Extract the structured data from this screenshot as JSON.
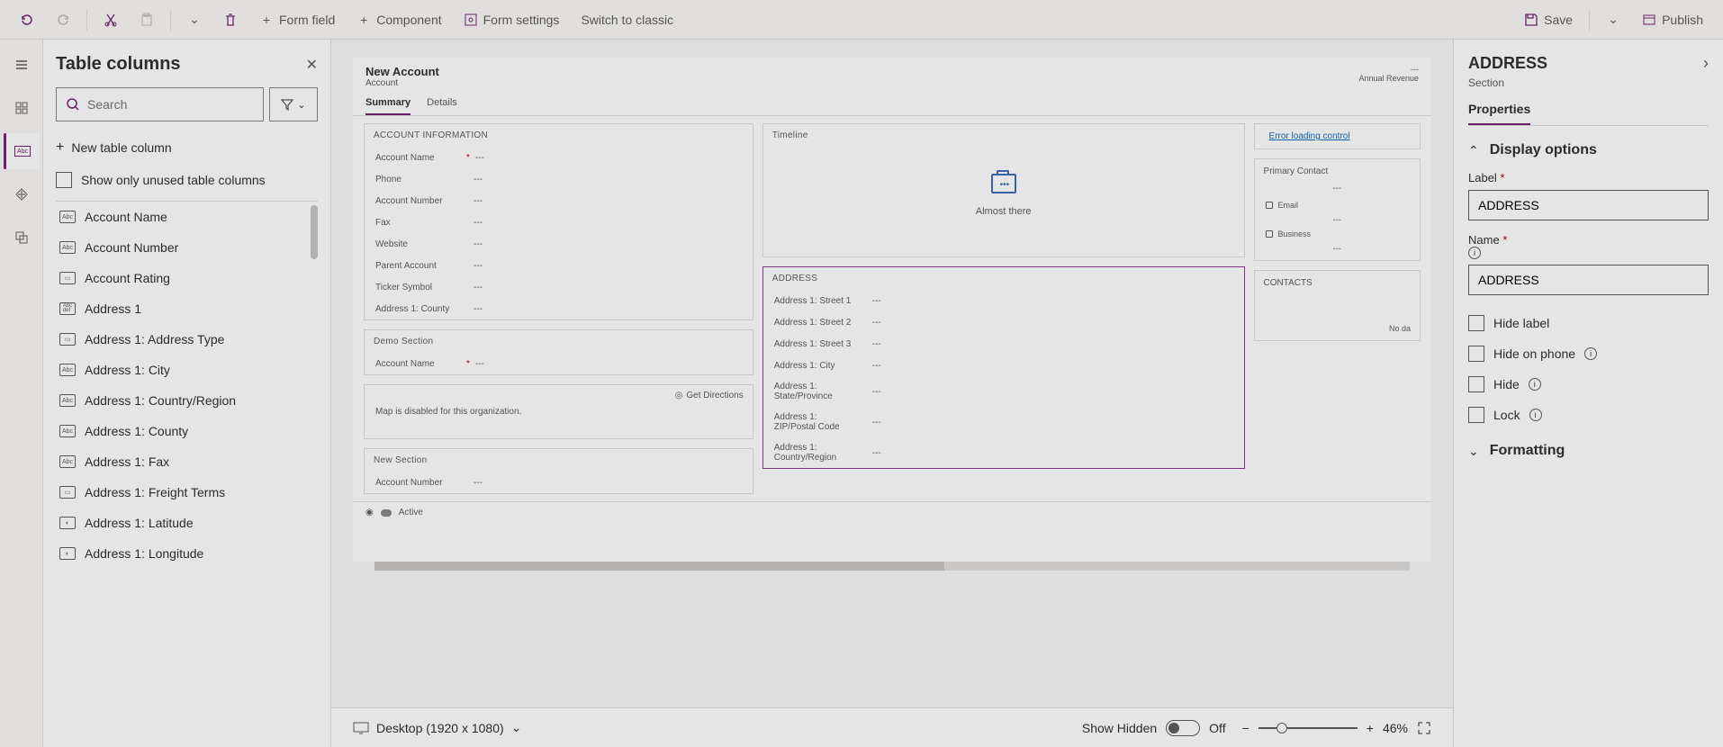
{
  "toolbar": {
    "form_field": "Form field",
    "component": "Component",
    "form_settings": "Form settings",
    "switch_classic": "Switch to classic",
    "save": "Save",
    "publish": "Publish"
  },
  "columns_panel": {
    "title": "Table columns",
    "search_placeholder": "Search",
    "new_column": "New table column",
    "show_unused": "Show only unused table columns",
    "items": [
      "Account Name",
      "Account Number",
      "Account Rating",
      "Address 1",
      "Address 1: Address Type",
      "Address 1: City",
      "Address 1: Country/Region",
      "Address 1: County",
      "Address 1: Fax",
      "Address 1: Freight Terms",
      "Address 1: Latitude",
      "Address 1: Longitude"
    ]
  },
  "canvas": {
    "form_title": "New Account",
    "form_entity": "Account",
    "annual_revenue": "Annual Revenue",
    "tabs": [
      "Summary",
      "Details"
    ],
    "account_info": {
      "header": "ACCOUNT INFORMATION",
      "fields": [
        "Account Name",
        "Phone",
        "Account Number",
        "Fax",
        "Website",
        "Parent Account",
        "Ticker Symbol",
        "Address 1: County"
      ]
    },
    "demo_section": {
      "header": "Demo Section",
      "field": "Account Name"
    },
    "map": {
      "get_directions": "Get Directions",
      "disabled": "Map is disabled for this organization."
    },
    "new_section": {
      "header": "New Section",
      "field": "Account Number"
    },
    "timeline": {
      "header": "Timeline",
      "msg": "Almost there"
    },
    "address": {
      "header": "ADDRESS",
      "fields": [
        "Address 1: Street 1",
        "Address 1: Street 2",
        "Address 1: Street 3",
        "Address 1: City",
        "Address 1: State/Province",
        "Address 1: ZIP/Postal Code",
        "Address 1: Country/Region"
      ]
    },
    "side": {
      "error": "Error loading control",
      "primary_contact": "Primary Contact",
      "email": "Email",
      "business": "Business",
      "contacts": "CONTACTS",
      "no_data": "No da"
    },
    "status": "Active"
  },
  "footer": {
    "viewport": "Desktop (1920 x 1080)",
    "show_hidden": "Show Hidden",
    "toggle_off": "Off",
    "zoom": "46%"
  },
  "props": {
    "title": "ADDRESS",
    "subtitle": "Section",
    "tab": "Properties",
    "accordion_display": "Display options",
    "label_label": "Label",
    "label_value": "ADDRESS",
    "name_label": "Name",
    "name_value": "ADDRESS",
    "hide_label": "Hide label",
    "hide_phone": "Hide on phone",
    "hide": "Hide",
    "lock": "Lock",
    "accordion_formatting": "Formatting"
  }
}
